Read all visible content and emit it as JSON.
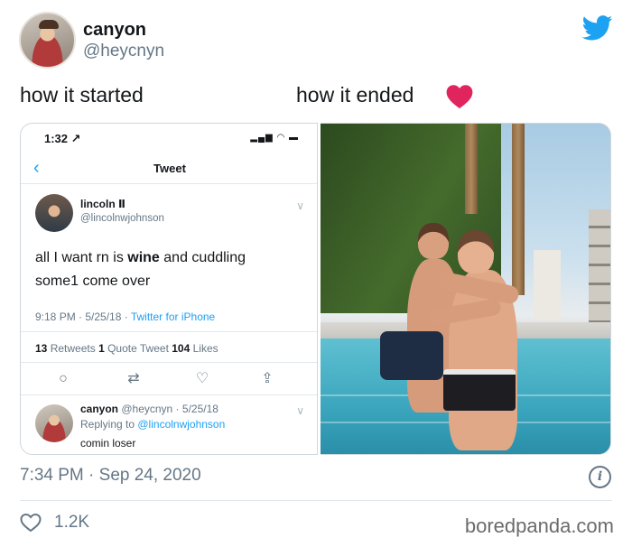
{
  "author": {
    "display_name": "canyon",
    "handle": "@heycnyn"
  },
  "captions": {
    "left": "how it started",
    "right": "how it ended"
  },
  "embedded_tweet": {
    "status_time": "1:32",
    "nav_title": "Tweet",
    "original": {
      "name": "lincoln Ⅱ",
      "handle": "@lincolnwjohnson",
      "line1_pre": "all I want rn is ",
      "line1_bold": "wine",
      "line1_post": " and cuddling",
      "line2": "some1 come over",
      "time": "9:18 PM · 5/25/18 · ",
      "source": "Twitter for iPhone",
      "retweets": "13",
      "retweets_label": " Retweets ",
      "quotes": "1",
      "quotes_label": " Quote Tweet ",
      "likes": "104",
      "likes_label": " Likes"
    },
    "reply": {
      "name": "canyon",
      "meta": " @heycnyn · 5/25/18",
      "replying_to_label": "Replying to ",
      "replying_to_handle": "@lincolnwjohnson",
      "text": "comin loser"
    }
  },
  "footer": {
    "timestamp": "7:34 PM · Sep 24, 2020",
    "likes": "1.2K",
    "watermark": "boredpanda.com"
  },
  "colors": {
    "twitter_blue": "#1da1f2",
    "heart_red": "#e0245e",
    "muted": "#657786"
  },
  "icons": [
    "twitter-bird-icon",
    "red-heart-icon",
    "back-chevron-icon",
    "reply-icon",
    "retweet-icon",
    "like-icon",
    "share-icon",
    "info-icon",
    "heart-outline-icon"
  ]
}
